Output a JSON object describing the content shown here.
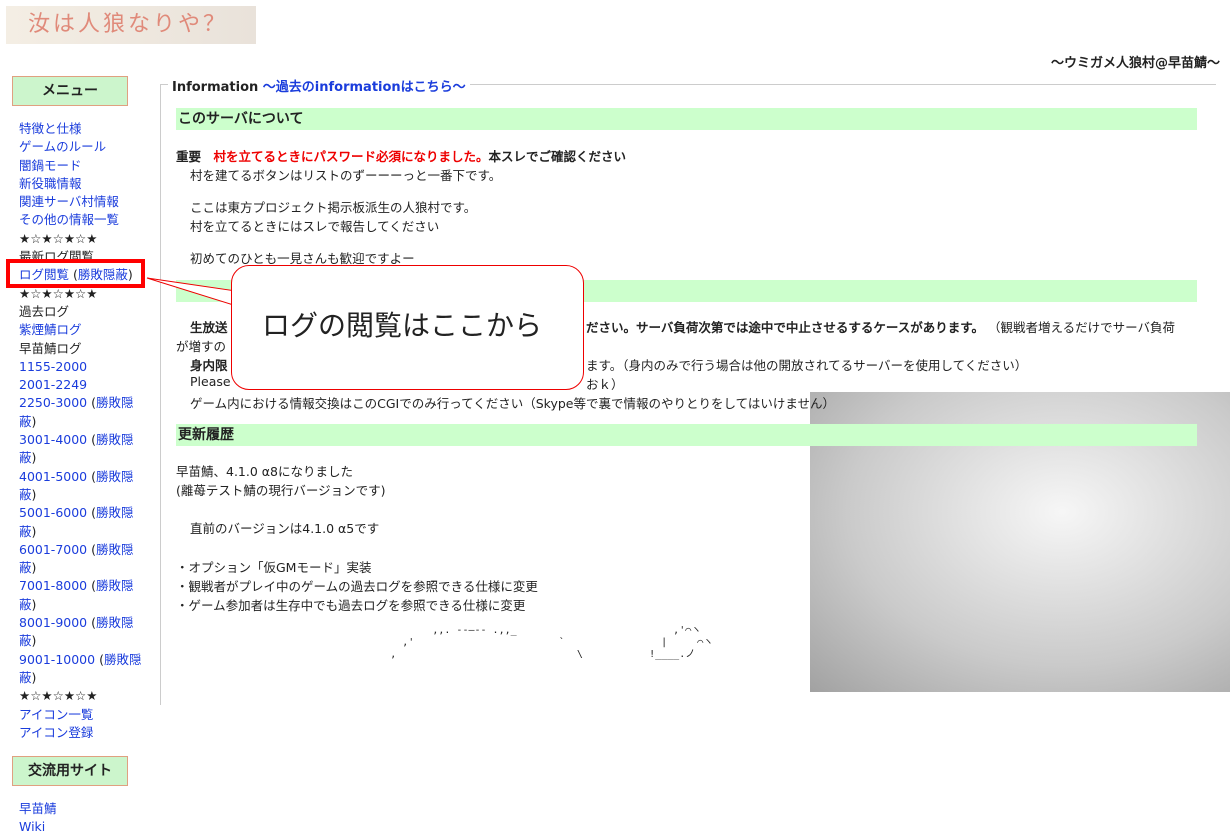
{
  "logo": "汝は人狼なりや？",
  "village": "～ウミガメ人狼村@早苗鯖～",
  "menu_title": "メニュー",
  "menu": [
    "特徴と仕様",
    "ゲームのルール",
    "闇鍋モード",
    "新役職情報",
    "関連サーバ村情報",
    "その他の情報一覧"
  ],
  "stars": "★☆★☆★☆★",
  "latest_log": "最新ログ閲覧",
  "log_view": "ログ閲覧",
  "hidden": "勝敗隠蔽",
  "past_log": "過去ログ",
  "shien_log": "紫煙鯖ログ",
  "sanae_log": "早苗鯖ログ",
  "ranges": [
    "1155-2000",
    "2001-2249",
    "2250-3000",
    "3001-4000",
    "4001-5000",
    "5001-6000",
    "6001-7000",
    "7001-8000",
    "8001-9000",
    "9001-10000"
  ],
  "icon_list": "アイコン一覧",
  "icon_reg": "アイコン登録",
  "exchange_title": "交流用サイト",
  "ex_links": [
    "早苗鯖",
    "Wiki"
  ],
  "info": {
    "label": "Information",
    "past": "～過去のinformationはこちら～"
  },
  "sec1": "このサーバについて",
  "important": "重要",
  "important_red": "村を立てるときにパスワード必須になりました。",
  "important_rest": "本スレでご確認ください",
  "l1": "村を建てるボタンはリストのずーーーっと一番下です。",
  "l2": "ここは東方プロジェクト掲示板派生の人狼村です。",
  "l3": "村を立てるときにはスレで報告してください",
  "l4": "初めてのひとも一見さんも歓迎ですよー",
  "r1a": "生放送",
  "r1b": "ださい。サーバ負荷次第では途中で中止させるするケースがあります。",
  "r1c": "（観戦者増えるだけでサーバ負荷",
  "r2": "が増すの",
  "r3a": "身内限",
  "r3b": "ます。（身内のみで行う場合は他の開放されてるサーバーを使用してください）",
  "r4a": "Please",
  "r4b": "おｋ）",
  "r5": "ゲーム内における情報交換はこのCGIでのみ行ってください（Skype等で裏で情報のやりとりをしてはいけません）",
  "sec3": "更新履歴",
  "u1": "早苗鯖、4.1.0 α8になりました",
  "u2": "(離苺テスト鯖の現行バージョンです)",
  "u3": "直前のバージョンは4.1.0 α5です",
  "u4": "・オプション「仮GMモード」実装",
  "u5": "・観戦者がプレイ中のゲームの過去ログを参照できる仕様に変更",
  "u6": "・ゲーム参加者は生存中でも過去ログを参照できる仕様に変更",
  "callout": "ログの閲覧はここから"
}
